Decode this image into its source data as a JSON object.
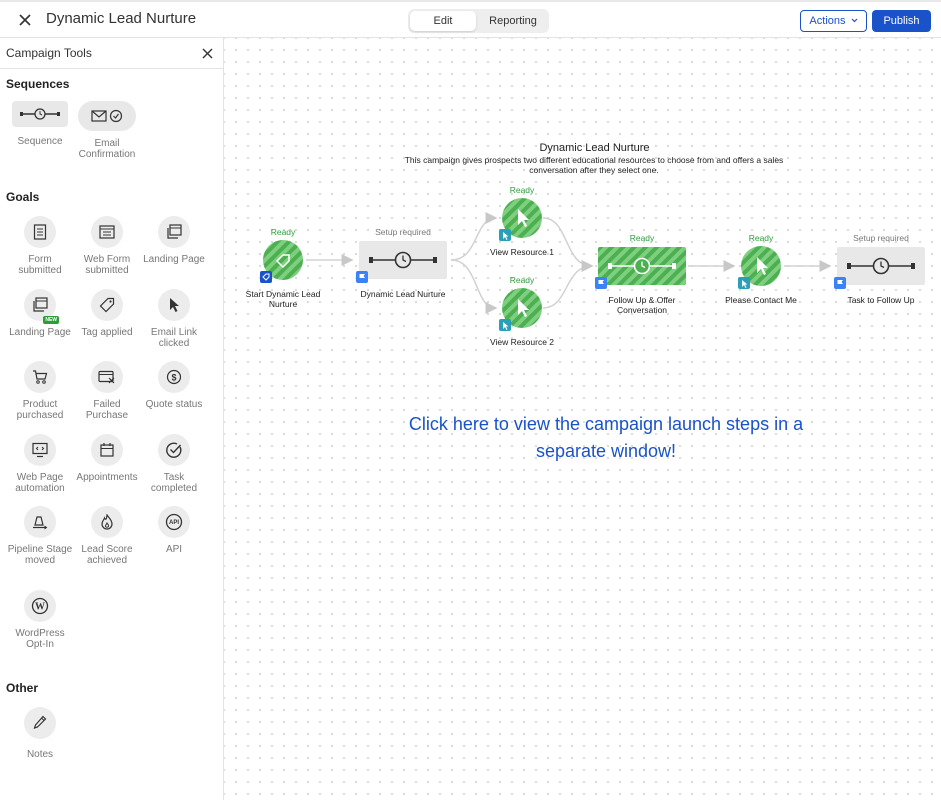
{
  "header": {
    "title": "Dynamic Lead Nurture",
    "tabs": [
      {
        "label": "Edit",
        "active": true
      },
      {
        "label": "Reporting",
        "active": false
      }
    ],
    "actions_label": "Actions",
    "publish_label": "Publish"
  },
  "sidebar": {
    "title": "Campaign Tools",
    "sections": {
      "sequences": "Sequences",
      "goals": "Goals",
      "other": "Other"
    },
    "sequences": [
      {
        "label": "Sequence",
        "icon": "clock-timeline-icon"
      },
      {
        "label": "Email Confirmation",
        "icon": "email-check-icon"
      }
    ],
    "goals": [
      {
        "label": "Form submitted",
        "icon": "form-icon"
      },
      {
        "label": "Web Form submitted",
        "icon": "web-form-icon"
      },
      {
        "label": "Landing Page",
        "icon": "landing-page-icon"
      },
      {
        "label": "Landing Page",
        "icon": "landing-page-new-icon",
        "badge": "NEW"
      },
      {
        "label": "Tag applied",
        "icon": "tag-icon"
      },
      {
        "label": "Email Link clicked",
        "icon": "cursor-icon"
      },
      {
        "label": "Product purchased",
        "icon": "cart-icon"
      },
      {
        "label": "Failed Purchase",
        "icon": "failed-card-icon"
      },
      {
        "label": "Quote status",
        "icon": "dollar-icon"
      },
      {
        "label": "Web Page automation",
        "icon": "monitor-code-icon"
      },
      {
        "label": "Appointments",
        "icon": "calendar-icon"
      },
      {
        "label": "Task completed",
        "icon": "check-circle-icon"
      },
      {
        "label": "Pipeline Stage moved",
        "icon": "pipeline-icon"
      },
      {
        "label": "Lead Score achieved",
        "icon": "flame-icon"
      },
      {
        "label": "API",
        "icon": "api-icon"
      },
      {
        "label": "WordPress Opt-In",
        "icon": "wordpress-icon"
      }
    ],
    "other": [
      {
        "label": "Notes",
        "icon": "pencil-icon"
      }
    ]
  },
  "canvas": {
    "title": "Dynamic Lead Nurture",
    "description": "This campaign gives prospects two different educational resources to choose from and offers a sales conversation after they select one.",
    "nodes": [
      {
        "id": "start",
        "status": "Ready",
        "label": "Start Dynamic Lead Nurture"
      },
      {
        "id": "seq1",
        "status": "Setup required",
        "label": "Dynamic Lead Nurture"
      },
      {
        "id": "res1",
        "status": "Ready",
        "label": "View Resource 1"
      },
      {
        "id": "res2",
        "status": "Ready",
        "label": "View Resource 2"
      },
      {
        "id": "followup",
        "status": "Ready",
        "label": "Follow Up & Offer Conversation"
      },
      {
        "id": "contact",
        "status": "Ready",
        "label": "Please Contact Me"
      },
      {
        "id": "task",
        "status": "Setup required",
        "label": "Task to Follow Up"
      }
    ],
    "launch_link": "Click here to view the campaign launch steps in a separate window!",
    "colors": {
      "ready": "#2e9c3c",
      "accent": "#1a52c9",
      "goal_green": "#4caf50"
    }
  }
}
